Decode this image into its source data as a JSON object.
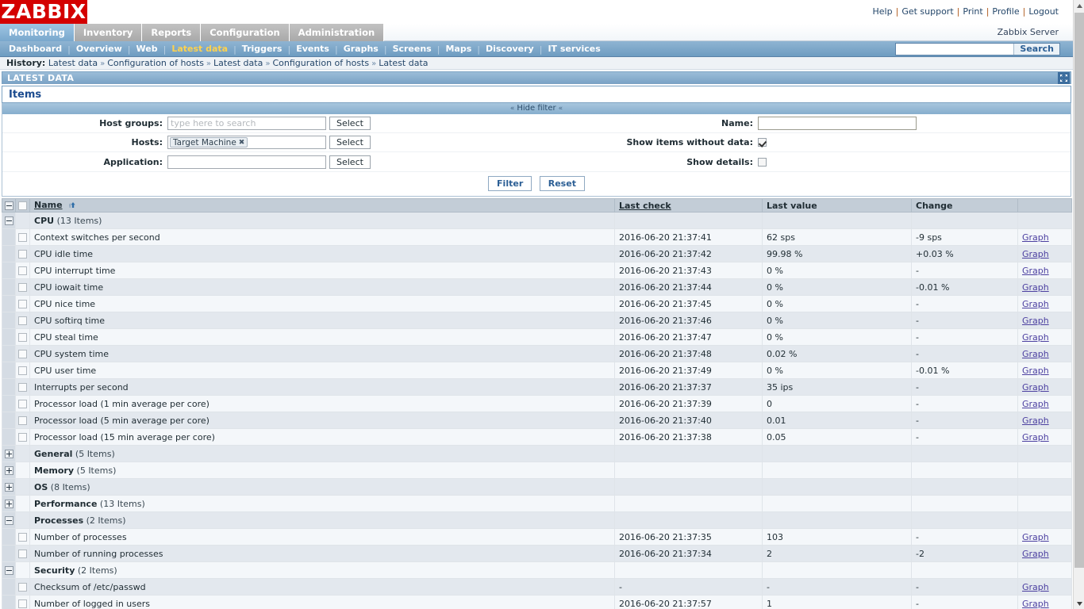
{
  "brand": {
    "logo_text": "ZABBIX",
    "logo_bg": "#d40000",
    "accent": "#1b4b8f",
    "selected_menu_color": "#ffd24d"
  },
  "userlinks": [
    {
      "label": "Help"
    },
    {
      "label": "Get support"
    },
    {
      "label": "Print"
    },
    {
      "label": "Profile"
    },
    {
      "label": "Logout"
    }
  ],
  "main_menu": {
    "tabs": [
      {
        "label": "Monitoring",
        "active": true
      },
      {
        "label": "Inventory",
        "active": false
      },
      {
        "label": "Reports",
        "active": false
      },
      {
        "label": "Configuration",
        "active": false
      },
      {
        "label": "Administration",
        "active": false
      }
    ],
    "server_name": "Zabbix Server"
  },
  "sub_menu": {
    "items": [
      {
        "label": "Dashboard",
        "selected": false
      },
      {
        "label": "Overview",
        "selected": false
      },
      {
        "label": "Web",
        "selected": false
      },
      {
        "label": "Latest data",
        "selected": true
      },
      {
        "label": "Triggers",
        "selected": false
      },
      {
        "label": "Events",
        "selected": false
      },
      {
        "label": "Graphs",
        "selected": false
      },
      {
        "label": "Screens",
        "selected": false
      },
      {
        "label": "Maps",
        "selected": false
      },
      {
        "label": "Discovery",
        "selected": false
      },
      {
        "label": "IT services",
        "selected": false
      }
    ],
    "divider": "|"
  },
  "search": {
    "value": "",
    "placeholder": "",
    "button_label": "Search"
  },
  "history": {
    "label": "History:",
    "arrow": "»",
    "crumbs": [
      "Latest data",
      "Configuration of hosts",
      "Latest data",
      "Configuration of hosts",
      "Latest data"
    ]
  },
  "page": {
    "section_title": "LATEST DATA",
    "heading": "Items",
    "fullscreen_icon": "fullscreen-icon"
  },
  "filter": {
    "toggle_label": "Hide filter",
    "chevron": "«",
    "host_groups": {
      "label": "Host groups:",
      "value": "",
      "placeholder": "type here to search",
      "select_label": "Select"
    },
    "hosts": {
      "label": "Hosts:",
      "chip": "Target Machine",
      "chip_remove": "✖",
      "value": "",
      "select_label": "Select"
    },
    "application": {
      "label": "Application:",
      "value": "",
      "placeholder": "",
      "select_label": "Select"
    },
    "name": {
      "label": "Name:",
      "value": "",
      "placeholder": ""
    },
    "show_items_without_data": {
      "label": "Show items without data:",
      "checked": true
    },
    "show_details": {
      "label": "Show details:",
      "checked": false
    },
    "filter_button": "Filter",
    "reset_button": "Reset"
  },
  "table": {
    "columns": [
      {
        "label": "Name",
        "sortable": true,
        "sorted": "asc"
      },
      {
        "label": "Last check",
        "sortable": true,
        "sorted": null
      },
      {
        "label": "Last value",
        "sortable": false,
        "sorted": null
      },
      {
        "label": "Change",
        "sortable": false,
        "sorted": null
      },
      {
        "label": "",
        "sortable": false,
        "sorted": null
      }
    ],
    "graph_link_label": "Graph",
    "groups": [
      {
        "name": "CPU",
        "count": "(13 Items)",
        "expanded": true,
        "rows": [
          {
            "name": "Context switches per second",
            "last_check": "2016-06-20 21:37:41",
            "last_value": "62 sps",
            "change": "-9 sps"
          },
          {
            "name": "CPU idle time",
            "last_check": "2016-06-20 21:37:42",
            "last_value": "99.98 %",
            "change": "+0.03 %"
          },
          {
            "name": "CPU interrupt time",
            "last_check": "2016-06-20 21:37:43",
            "last_value": "0 %",
            "change": "-"
          },
          {
            "name": "CPU iowait time",
            "last_check": "2016-06-20 21:37:44",
            "last_value": "0 %",
            "change": "-0.01 %"
          },
          {
            "name": "CPU nice time",
            "last_check": "2016-06-20 21:37:45",
            "last_value": "0 %",
            "change": "-"
          },
          {
            "name": "CPU softirq time",
            "last_check": "2016-06-20 21:37:46",
            "last_value": "0 %",
            "change": "-"
          },
          {
            "name": "CPU steal time",
            "last_check": "2016-06-20 21:37:47",
            "last_value": "0 %",
            "change": "-"
          },
          {
            "name": "CPU system time",
            "last_check": "2016-06-20 21:37:48",
            "last_value": "0.02 %",
            "change": "-"
          },
          {
            "name": "CPU user time",
            "last_check": "2016-06-20 21:37:49",
            "last_value": "0 %",
            "change": "-0.01 %"
          },
          {
            "name": "Interrupts per second",
            "last_check": "2016-06-20 21:37:37",
            "last_value": "35 ips",
            "change": "-"
          },
          {
            "name": "Processor load (1 min average per core)",
            "last_check": "2016-06-20 21:37:39",
            "last_value": "0",
            "change": "-"
          },
          {
            "name": "Processor load (5 min average per core)",
            "last_check": "2016-06-20 21:37:40",
            "last_value": "0.01",
            "change": "-"
          },
          {
            "name": "Processor load (15 min average per core)",
            "last_check": "2016-06-20 21:37:38",
            "last_value": "0.05",
            "change": "-"
          }
        ]
      },
      {
        "name": "General",
        "count": "(5 Items)",
        "expanded": false,
        "rows": []
      },
      {
        "name": "Memory",
        "count": "(5 Items)",
        "expanded": false,
        "rows": []
      },
      {
        "name": "OS",
        "count": "(8 Items)",
        "expanded": false,
        "rows": []
      },
      {
        "name": "Performance",
        "count": "(13 Items)",
        "expanded": false,
        "rows": []
      },
      {
        "name": "Processes",
        "count": "(2 Items)",
        "expanded": true,
        "rows": [
          {
            "name": "Number of processes",
            "last_check": "2016-06-20 21:37:35",
            "last_value": "103",
            "change": "-"
          },
          {
            "name": "Number of running processes",
            "last_check": "2016-06-20 21:37:34",
            "last_value": "2",
            "change": "-2"
          }
        ]
      },
      {
        "name": "Security",
        "count": "(2 Items)",
        "expanded": true,
        "rows": [
          {
            "name": "Checksum of /etc/passwd",
            "last_check": "-",
            "last_value": "-",
            "change": "-"
          },
          {
            "name": "Number of logged in users",
            "last_check": "2016-06-20 21:37:57",
            "last_value": "1",
            "change": "-"
          }
        ]
      }
    ]
  },
  "scrollbar": {
    "up_arrow": "▲",
    "down_arrow": "▼"
  }
}
